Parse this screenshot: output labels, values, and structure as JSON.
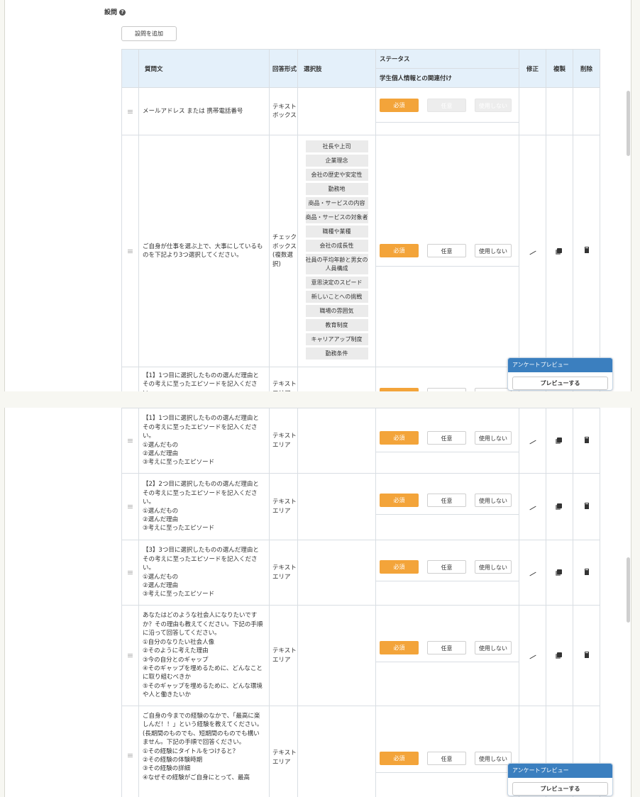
{
  "section": {
    "title": "設問",
    "help_icon": "question-circle-icon"
  },
  "add_button": "設問を追加",
  "headers": {
    "question": "質問文",
    "form_type": "回答形式",
    "options": "選択肢",
    "status": "ステータス",
    "link": "学生個人情報との関連付け",
    "edit": "修正",
    "copy": "複製",
    "delete": "削除"
  },
  "status_labels": {
    "required": "必須",
    "optional": "任意",
    "unused": "使用しない"
  },
  "icons": {
    "drag": "drag-handle-icon",
    "edit": "pencil-icon",
    "copy": "copy-icon",
    "delete": "trash-icon"
  },
  "colors": {
    "required": "#f3a43a",
    "header_bg": "#e4f0fa",
    "preview_header": "#3b7fbf"
  },
  "preview": {
    "title": "アンケートプレビュー",
    "button": "プレビューする"
  },
  "rows": [
    {
      "text": "メールアドレス または 携帯電話番号",
      "type": "テキストボックス",
      "options": [],
      "editable": false
    },
    {
      "text": "ご自身が仕事を選ぶ上で、大事にしているものを下記より3つ選択してください。",
      "type": "チェックボックス(複数選択)",
      "options": [
        "社長や上司",
        "企業理念",
        "会社の歴史や安定性",
        "勤務地",
        "商品・サービスの内容",
        "商品・サービスの対象者",
        "職種や業種",
        "会社の成長性",
        "社員の平均年齢と男女の人員構成",
        "意思決定のスピード",
        "新しいことへの挑戦",
        "職場の雰囲気",
        "教育制度",
        "キャリアアップ制度",
        "勤務条件"
      ],
      "editable": true
    },
    {
      "text": "【1】1つ目に選択したものの選んだ理由とその考えに至ったエピソードを記入ください。\n①選んだもの\n②選んだ理由\n③考えに至ったエピソード",
      "type": "テキストエリア",
      "options": [],
      "editable": true
    },
    {
      "text": "【2】2つ目に選択したものの選んだ理由とその考えに至ったエピソードを記入ください。\n①選んだもの\n②選んだ理由\n③考えに至ったエピソード",
      "type": "テキストエリア",
      "options": [],
      "editable": true
    },
    {
      "text": "【3】3つ目に選択したものの選んだ理由とその考えに至ったエピソードを記入ください。\n①選んだもの\n②選んだ理由\n③考えに至ったエピソード",
      "type": "テキストエリア",
      "options": [],
      "editable": true
    },
    {
      "text": "あなたはどのような社会人になりたいですか？その理由も教えてください。下記の手順に沿って回答してください。\n①自分のなりたい社会人像\n②そのように考えた理由\n③今の自分とのギャップ\n④そのギャップを埋めるために、どんなことに取り組むべきか\n⑤そのギャップを埋めるために、どんな環境や人と働きたいか",
      "type": "テキストエリア",
      "options": [],
      "editable": true
    },
    {
      "text": "ご自身の今までの経験のなかで、「最高に楽しんだ！！」という経験を教えてください。(長期間のものでも、短期間のものでも構いません。下記の手順で回答ください。\n①その経験にタイトルをつけると？\n②その経験の体験時期\n③その経験の詳細\n④なぜその経験がご自身にとって、最高",
      "type": "テキストエリア",
      "options": [],
      "editable": true
    }
  ]
}
